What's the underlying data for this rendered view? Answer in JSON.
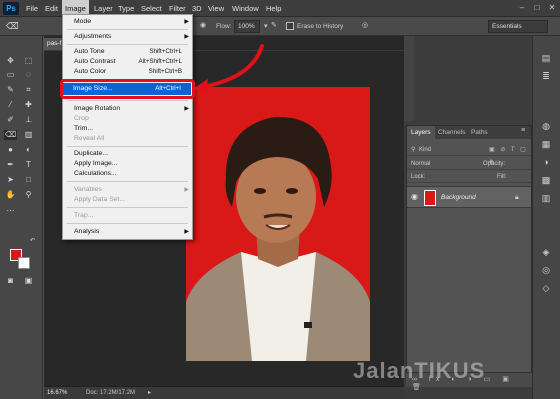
{
  "menubar": {
    "app_logo": "Ps",
    "items": [
      "File",
      "Edit",
      "Image",
      "Layer",
      "Type",
      "Select",
      "Filter",
      "3D",
      "View",
      "Window",
      "Help"
    ],
    "active_item": "Image"
  },
  "options_bar": {
    "flow_label": "Flow:",
    "flow_value": "100%",
    "erase_history_label": "Erase to History",
    "workspace": "Essentials"
  },
  "document": {
    "tab_label": "pas-f",
    "zoom": "16.67%",
    "doc_size": "Doc: 17.2M/17.2M"
  },
  "image_menu": {
    "items": [
      {
        "label": "Mode",
        "submenu": true
      },
      {
        "separator": true
      },
      {
        "label": "Adjustments",
        "submenu": true
      },
      {
        "separator": true
      },
      {
        "label": "Auto Tone",
        "shortcut": "Shift+Ctrl+L"
      },
      {
        "label": "Auto Contrast",
        "shortcut": "Alt+Shift+Ctrl+L"
      },
      {
        "label": "Auto Color",
        "shortcut": "Shift+Ctrl+B"
      },
      {
        "separator": true
      },
      {
        "label": "Image Size...",
        "shortcut": "Alt+Ctrl+I",
        "highlighted": true
      },
      {
        "separator": true
      },
      {
        "label": "Image Rotation",
        "submenu": true
      },
      {
        "label": "Crop",
        "disabled": true
      },
      {
        "label": "Trim..."
      },
      {
        "label": "Reveal All",
        "disabled": true
      },
      {
        "separator": true
      },
      {
        "label": "Duplicate..."
      },
      {
        "label": "Apply Image..."
      },
      {
        "label": "Calculations..."
      },
      {
        "separator": true
      },
      {
        "label": "Variables",
        "submenu": true,
        "disabled": true
      },
      {
        "label": "Apply Data Set...",
        "disabled": true
      },
      {
        "separator": true
      },
      {
        "label": "Trap...",
        "disabled": true
      },
      {
        "separator": true
      },
      {
        "label": "Analysis",
        "submenu": true
      }
    ]
  },
  "layers_panel": {
    "tabs": [
      "Layers",
      "Channels",
      "Paths"
    ],
    "kind_label": "Kind",
    "blend_mode": "Normal",
    "opacity_label": "Opacity:",
    "lock_label": "Lock:",
    "fill_label": "Fill:",
    "layer_name": "Background"
  },
  "colors": {
    "foreground": "#d8191c",
    "background": "#ffffff",
    "canvas_bg": "#d91818",
    "highlight": "#0a64d8",
    "annotation": "#e2101a"
  },
  "watermark": "JalanTIKUS"
}
